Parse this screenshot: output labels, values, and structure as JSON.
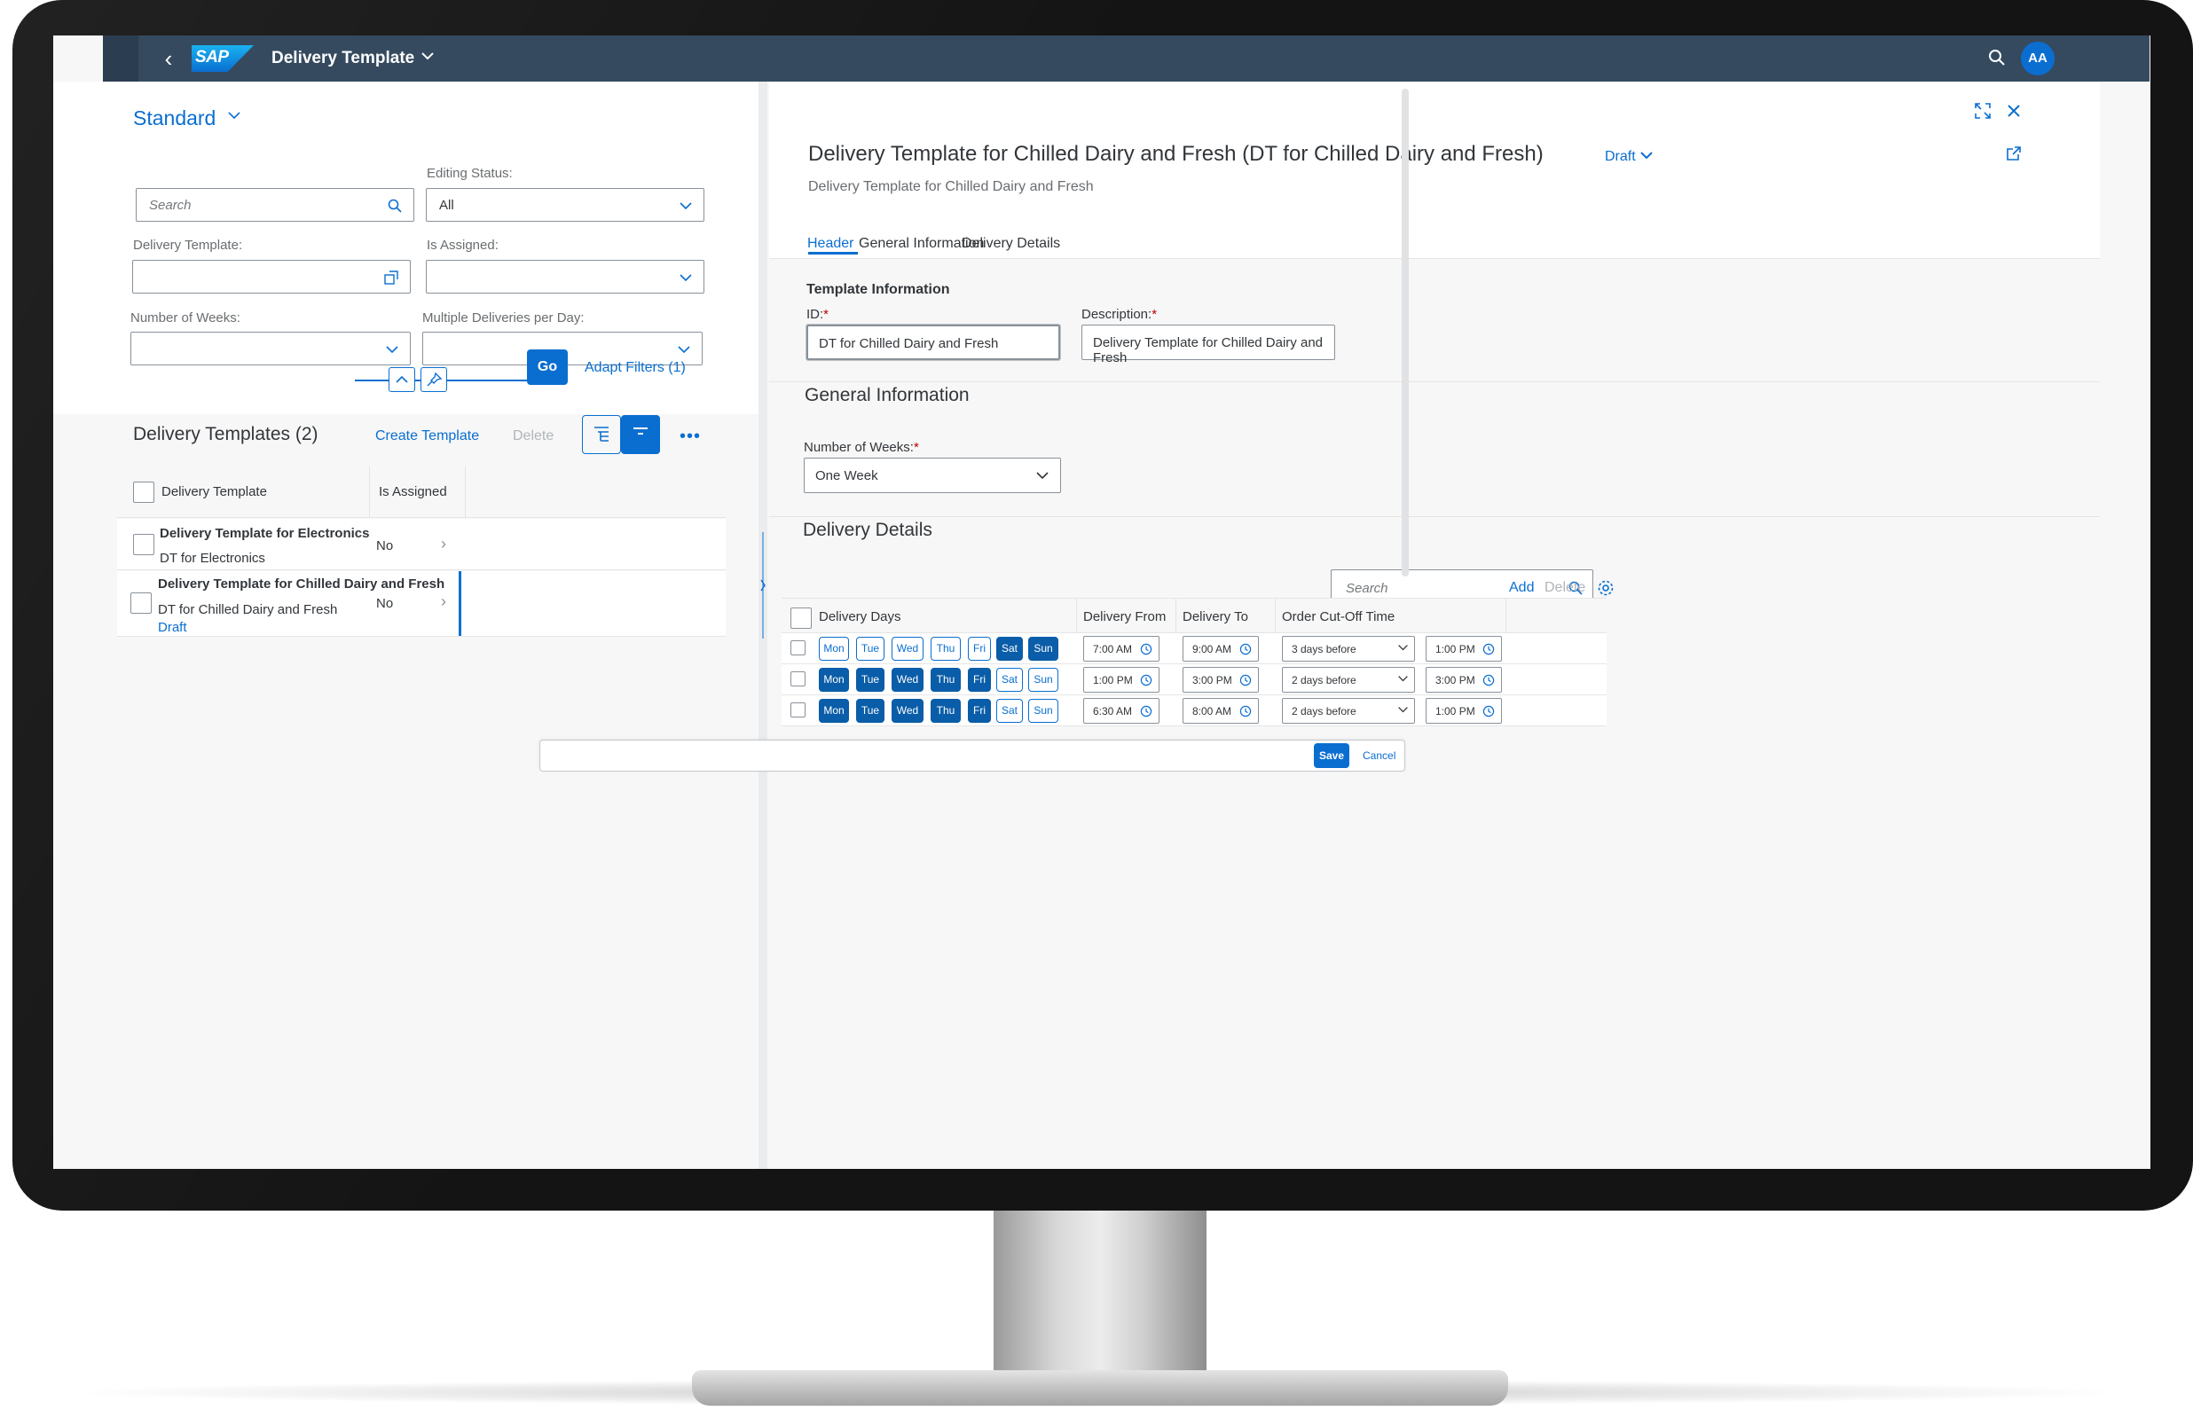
{
  "shell": {
    "logo_text": "SAP",
    "app_title": "Delivery Template",
    "avatar_initials": "AA"
  },
  "filter_bar": {
    "variant": "Standard",
    "search_placeholder": "Search",
    "editing_status_label": "Editing Status:",
    "editing_status_value": "All",
    "delivery_template_label": "Delivery Template:",
    "is_assigned_label": "Is Assigned:",
    "number_of_weeks_label": "Number of Weeks:",
    "multiple_deliveries_label": "Multiple Deliveries per Day:",
    "go_label": "Go",
    "adapt_filters_label": "Adapt Filters (1)"
  },
  "list": {
    "title": "Delivery Templates (2)",
    "create_label": "Create Template",
    "delete_label": "Delete",
    "more_label": "•••",
    "columns": [
      "Delivery Template",
      "Is Assigned"
    ],
    "rows": [
      {
        "title": "Delivery Template for Electronics",
        "id": "DT for Electronics",
        "assigned": "No",
        "status": ""
      },
      {
        "title": "Delivery Template for Chilled Dairy and Fresh",
        "id": "DT for Chilled Dairy and Fresh",
        "assigned": "No",
        "status": "Draft"
      }
    ]
  },
  "object": {
    "title": "Delivery Template for Chilled Dairy and Fresh (DT for Chilled Dairy and Fresh)",
    "draft_label": "Draft",
    "subtitle": "Delivery Template for Chilled Dairy and Fresh",
    "tabs": [
      "Header",
      "General Information",
      "Delivery Details"
    ],
    "template_info_title": "Template Information",
    "id_label": "ID:",
    "id_value": "DT for Chilled Dairy and Fresh",
    "description_label": "Description:",
    "description_value": "Delivery Template for Chilled Dairy and Fresh",
    "required_mark": "*",
    "general_info_title": "General Information",
    "weeks_label": "Number of Weeks:",
    "weeks_value": "One Week",
    "delivery_details_title": "Delivery Details",
    "dd_search_placeholder": "Search",
    "dd_add_label": "Add",
    "dd_delete_label": "Delete",
    "dd_columns": [
      "Delivery Days",
      "Delivery From",
      "Delivery To",
      "Order Cut-Off Time"
    ],
    "day_names": [
      "Mon",
      "Tue",
      "Wed",
      "Thu",
      "Fri",
      "Sat",
      "Sun"
    ],
    "dd_rows": [
      {
        "days_on": [
          false,
          false,
          false,
          false,
          false,
          true,
          true
        ],
        "from": "7:00 AM",
        "to": "9:00 AM",
        "cutoff_days": "3 days before",
        "cutoff_time": "1:00 PM"
      },
      {
        "days_on": [
          true,
          true,
          true,
          true,
          true,
          false,
          false
        ],
        "from": "1:00 PM",
        "to": "3:00 PM",
        "cutoff_days": "2 days before",
        "cutoff_time": "3:00 PM"
      },
      {
        "days_on": [
          true,
          true,
          true,
          true,
          true,
          false,
          false
        ],
        "from": "6:30 AM",
        "to": "8:00 AM",
        "cutoff_days": "2 days before",
        "cutoff_time": "1:00 PM"
      }
    ]
  },
  "footer": {
    "save_label": "Save",
    "cancel_label": "Cancel"
  },
  "colors": {
    "shell": "#354a5f",
    "accent": "#0a6ed1",
    "day_selected": "#0a5da8",
    "required": "#bb0000"
  }
}
